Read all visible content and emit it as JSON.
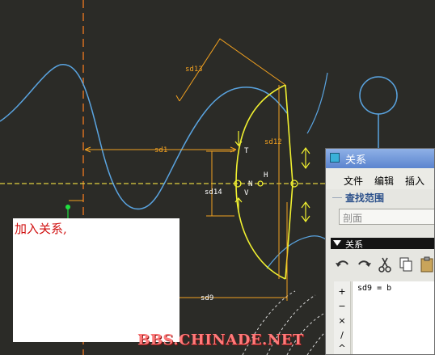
{
  "sketch": {
    "dimensions": {
      "sd13": "sd13",
      "sd1": "sd1",
      "sd12": "sd12",
      "sd14": "sd14",
      "sd9": "sd9"
    },
    "constraints": {
      "t": "T",
      "n": "N",
      "v": "V",
      "h": "H"
    },
    "colors": {
      "background": "#2b2b27",
      "curve": "#5aa4e0",
      "dimension": "#f0a020",
      "highlight": "#f0f030",
      "centerline": "#e0d040"
    }
  },
  "note": {
    "text": "加入关系,"
  },
  "watermark": "BBS.CHINADE.NET",
  "dialog": {
    "title": "关系",
    "menu": [
      "文件",
      "编辑",
      "插入"
    ],
    "search_group_label": "查找范围",
    "scope_value": "剖面",
    "relations_header": "关系",
    "toolbar_icons": [
      "undo-icon",
      "redo-icon",
      "cut-icon",
      "copy-icon",
      "paste-icon"
    ],
    "side_tools": [
      "+",
      "−",
      "×",
      "/",
      "^"
    ],
    "editor_text": "sd9 = b"
  }
}
